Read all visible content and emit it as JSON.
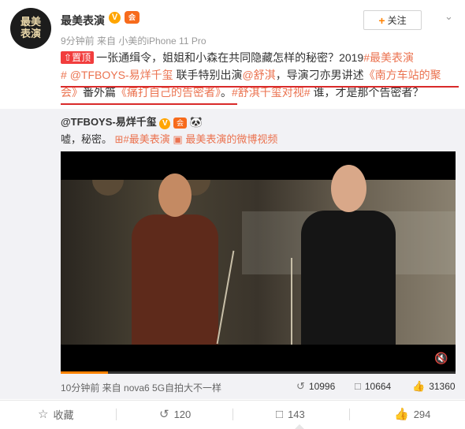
{
  "post": {
    "avatar_text": [
      "最美",
      "表演"
    ],
    "username": "最美表演",
    "verified_glyph": "V",
    "vip_glyph": "会",
    "meta": "9分钟前 来自 小美的iPhone 11 Pro",
    "follow_label": "关注",
    "pin_badge": "置顶",
    "text_1": "一张通缉令，姐姐和小森在共同隐藏怎样的秘密？2019",
    "hashtag_1": "#最美表演",
    "text_line2_a": "# ",
    "mention_1": "@TFBOYS-易烊千玺",
    "text_2": " 联手特别出演",
    "mention_2": "@舒淇",
    "text_3": "，导演刁亦男讲述",
    "link_1": "《南方车站的聚会》",
    "text_4": "番外篇",
    "link_2": "《痛打自己的告密者》",
    "text_5": "。",
    "hashtag_2": "#舒淇千玺对视#",
    "text_6": " 谁，才是那个告密者？"
  },
  "repost": {
    "user": "@TFBOYS-易烊千玺",
    "text": "嘘，秘密。",
    "hashtag": "#最美表演",
    "video_link": "最美表演的微博视频",
    "video_progress": 0.12,
    "mute_icon": "mute-icon",
    "meta": "10分钟前 来自 nova6 5G自拍大不一样",
    "reposts": "10996",
    "comments": "10664",
    "likes": "31360"
  },
  "actions": {
    "favorite": "收藏",
    "repost": "120",
    "comment": "143",
    "like": "294"
  },
  "colors": {
    "accent": "#eb7350",
    "orange": "#ff8200",
    "pin": "#f13d3d",
    "underline": "#d92a2a"
  }
}
